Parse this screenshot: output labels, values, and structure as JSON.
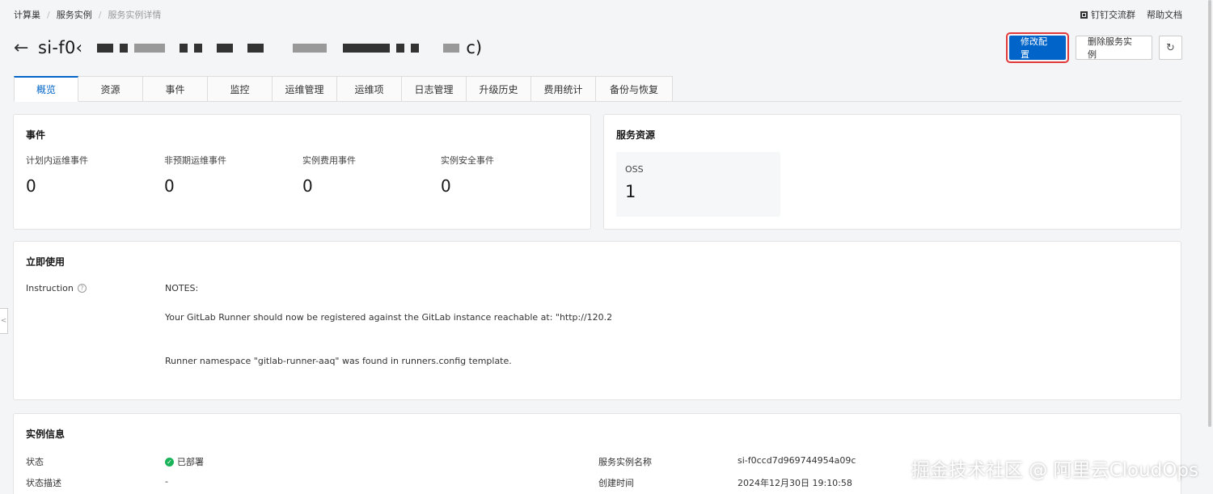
{
  "breadcrumb": {
    "items": [
      "计算巢",
      "服务实例"
    ],
    "current": "服务实例详情",
    "separator": "/"
  },
  "top_links": {
    "dingtalk": "钉钉交流群",
    "docs": "帮助文档"
  },
  "header": {
    "title": "si-f0‹",
    "title_tail": "c)",
    "modify_button": "修改配置",
    "delete_button": "删除服务实例",
    "refresh_icon": "↻"
  },
  "tabs": [
    "概览",
    "资源",
    "事件",
    "监控",
    "运维管理",
    "运维项",
    "日志管理",
    "升级历史",
    "费用统计",
    "备份与恢复"
  ],
  "events": {
    "title": "事件",
    "items": [
      {
        "label": "计划内运维事件",
        "value": "0"
      },
      {
        "label": "非预期运维事件",
        "value": "0"
      },
      {
        "label": "实例费用事件",
        "value": "0"
      },
      {
        "label": "实例安全事件",
        "value": "0"
      }
    ]
  },
  "resources": {
    "title": "服务资源",
    "oss_label": "OSS",
    "oss_value": "1"
  },
  "usage": {
    "title": "立即使用",
    "key": "Instruction",
    "lines": [
      "NOTES:",
      "Your GitLab Runner should now be registered against the GitLab instance reachable at: \"http://120.2",
      "Runner namespace \"gitlab-runner-aaq\" was found in runners.config template."
    ]
  },
  "instance_info": {
    "title": "实例信息",
    "status_label": "状态",
    "status_value": "已部署",
    "status_desc_label": "状态描述",
    "status_desc_value": "-",
    "name_label": "服务实例名称",
    "name_value": "si-f0ccd7d969744954a09c",
    "created_label": "创建时间",
    "created_value": "2024年12月30日 19:10:58"
  },
  "watermark": "掘金技术社区 @ 阿里云CloudOps",
  "colors": {
    "primary": "#0064c8",
    "highlight": "#e23a3a",
    "success": "#1ab35a"
  }
}
